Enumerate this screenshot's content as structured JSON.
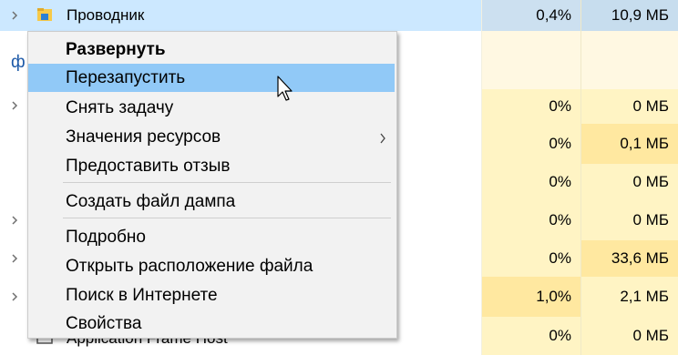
{
  "process_list": {
    "header_row": {
      "name": "Проводник",
      "cpu": "0,4%",
      "memory": "10,9 МБ"
    },
    "group_glyph": "ф",
    "rows": [
      {
        "cpu": "0%",
        "memory": "0 МБ"
      },
      {
        "cpu": "0%",
        "memory": "0,1 МБ"
      },
      {
        "cpu": "0%",
        "memory": "0 МБ"
      },
      {
        "cpu": "0%",
        "memory": "0 МБ"
      },
      {
        "cpu": "0%",
        "memory": "33,6 МБ"
      },
      {
        "cpu": "1,0%",
        "memory": "2,1 МБ"
      },
      {
        "cpu": "0%",
        "memory": "0 МБ"
      }
    ],
    "bottom_partial_name": "Application Frame Host"
  },
  "context_menu": {
    "items": [
      {
        "label": "Развернуть"
      },
      {
        "label": "Перезапустить"
      },
      {
        "label": "Снять задачу"
      },
      {
        "label": "Значения ресурсов"
      },
      {
        "label": "Предоставить отзыв"
      },
      {
        "label": "Создать файл дампа"
      },
      {
        "label": "Подробно"
      },
      {
        "label": "Открыть расположение файла"
      },
      {
        "label": "Поиск в Интернете"
      },
      {
        "label": "Свойства"
      }
    ]
  },
  "colors": {
    "selected_row": "#cce8ff",
    "menu_highlight": "#91c9f7",
    "heat_light": "#fff4c4",
    "heat_medium": "#ffe8a0"
  }
}
